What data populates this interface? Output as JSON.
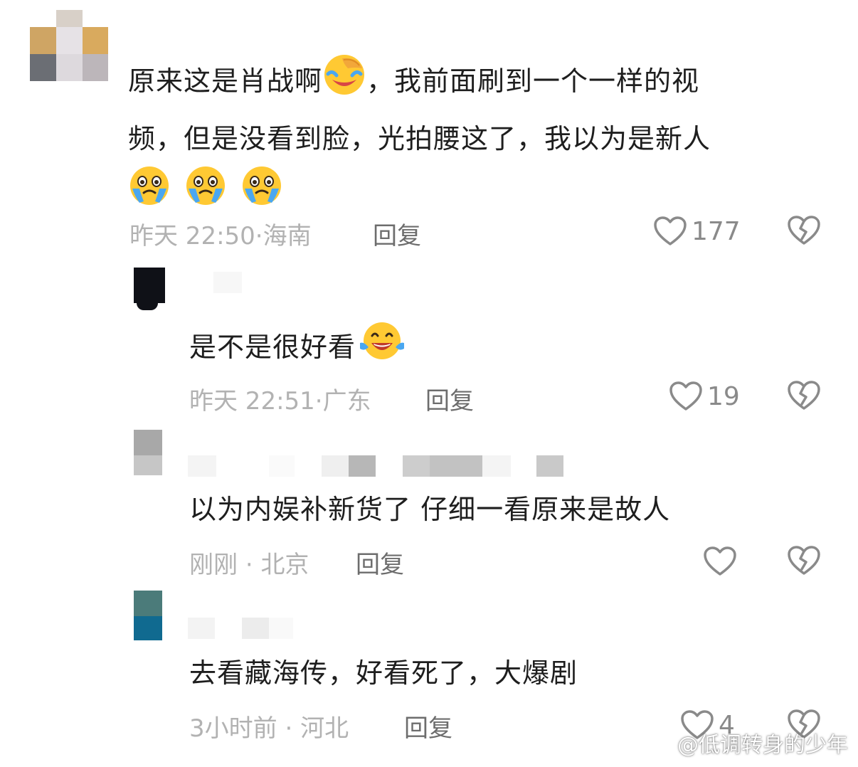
{
  "comments": [
    {
      "text_line1": "原来这是肖战啊",
      "text_line1b": "，我前面刷到一个一样的视",
      "text_line2": "频，但是没看到脸，光拍腰这了，我以为是新人",
      "emojis_line1": [
        "facepalm-laugh-emoji"
      ],
      "emojis_line3": [
        "crying-emoji",
        "crying-emoji",
        "crying-emoji"
      ],
      "time": "昨天 22:50",
      "location": "海南",
      "reply_label": "回复",
      "likes": "177"
    },
    {
      "text": "是不是很好看",
      "emojis": [
        "tears-of-joy-emoji"
      ],
      "time": "昨天 22:51",
      "location": "广东",
      "reply_label": "回复",
      "likes": "19"
    },
    {
      "text": "以为内娱补新货了 仔细一看原来是故人",
      "time": "刚刚",
      "location": "北京",
      "reply_label": "回复",
      "likes": ""
    },
    {
      "text": "去看藏海传，好看死了，大爆剧",
      "time": "3小时前",
      "location": "河北",
      "reply_label": "回复",
      "likes": "4"
    }
  ],
  "meta_separator": "·",
  "watermark": "@低调转身的少年",
  "icons": {
    "like": "heart-outline-icon",
    "dislike": "broken-heart-icon",
    "watermark": "weibo-logo-icon"
  },
  "colors": {
    "text": "#1e1e1e",
    "meta": "#b2b2b2",
    "reply": "#6d6d6d",
    "icon": "#8a8a8a",
    "emoji_yellow": "#ffc933",
    "emoji_tear": "#4aa7f0"
  }
}
